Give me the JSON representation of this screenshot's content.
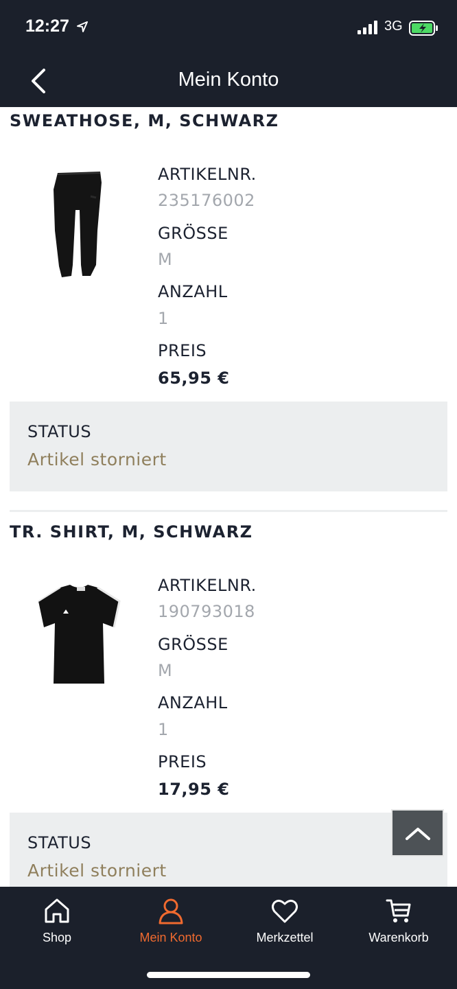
{
  "status_bar": {
    "time": "12:27",
    "network": "3G"
  },
  "header": {
    "title": "Mein Konto"
  },
  "items": [
    {
      "title": "SWEATHOSE, M, SCHWARZ",
      "article_label": "ARTIKELNR.",
      "article_number": "235176002",
      "size_label": "GRÖSSE",
      "size": "M",
      "quantity_label": "ANZAHL",
      "quantity": "1",
      "price_label": "PREIS",
      "price": "65,95 €",
      "status_label": "STATUS",
      "status": "Artikel storniert",
      "image_icon": "sweatpants-image"
    },
    {
      "title": "TR. SHIRT, M, SCHWARZ",
      "article_label": "ARTIKELNR.",
      "article_number": "190793018",
      "size_label": "GRÖSSE",
      "size": "M",
      "quantity_label": "ANZAHL",
      "quantity": "1",
      "price_label": "PREIS",
      "price": "17,95 €",
      "status_label": "STATUS",
      "status": "Artikel storniert",
      "image_icon": "tshirt-image"
    }
  ],
  "tab_bar": {
    "tabs": [
      {
        "label": "Shop",
        "icon": "home-icon",
        "active": false
      },
      {
        "label": "Mein Konto",
        "icon": "user-icon",
        "active": true
      },
      {
        "label": "Merkzettel",
        "icon": "heart-icon",
        "active": false
      },
      {
        "label": "Warenkorb",
        "icon": "cart-icon",
        "active": false
      }
    ]
  },
  "colors": {
    "header_bg": "#1b202b",
    "accent": "#f06a2f",
    "status_text": "#8f7f5c",
    "muted_text": "#a3a7ad",
    "status_box_bg": "#eceeef"
  }
}
